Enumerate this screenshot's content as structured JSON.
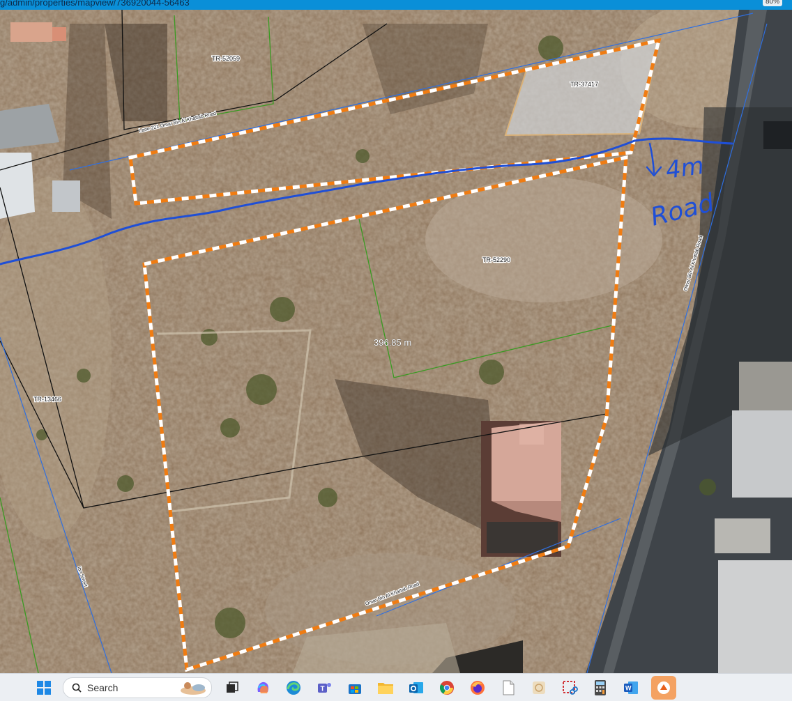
{
  "browser": {
    "url": "g/admin/properties/mapview/736920044-56463",
    "zoom": "80%"
  },
  "map": {
    "parcel_labels": {
      "tr52059": "TR-52059",
      "tr37417": "TR-37417",
      "tr52290": "TR-52290",
      "tr13466": "TR-13466"
    },
    "road_labels": {
      "lane221": "Lane 221 Omar Bin Al Khattab Road",
      "omar_main": "Omar Bin Al Khattab Road",
      "omar_bottom": "Omar Bin Al Khattab Road",
      "side_street": "Ibn Street"
    },
    "measurement": "396.85 m",
    "annotation": {
      "line1": "4m",
      "line2": "Road"
    },
    "colors": {
      "highlight": "#f07c12",
      "annotation": "#1f4fd6",
      "parcel_green": "#3a9a22",
      "road_line": "#2f6fe0"
    }
  },
  "taskbar": {
    "search_label": "Search",
    "apps": [
      "start-icon",
      "task-view-icon",
      "copilot-icon",
      "edge-icon",
      "teams-icon",
      "store-icon",
      "file-explorer-icon",
      "outlook-icon",
      "chrome-icon",
      "firefox-icon",
      "notepad-icon",
      "paint-icon",
      "snipping-tool-icon",
      "calculator-icon",
      "word-icon",
      "unknown-app-icon"
    ]
  }
}
